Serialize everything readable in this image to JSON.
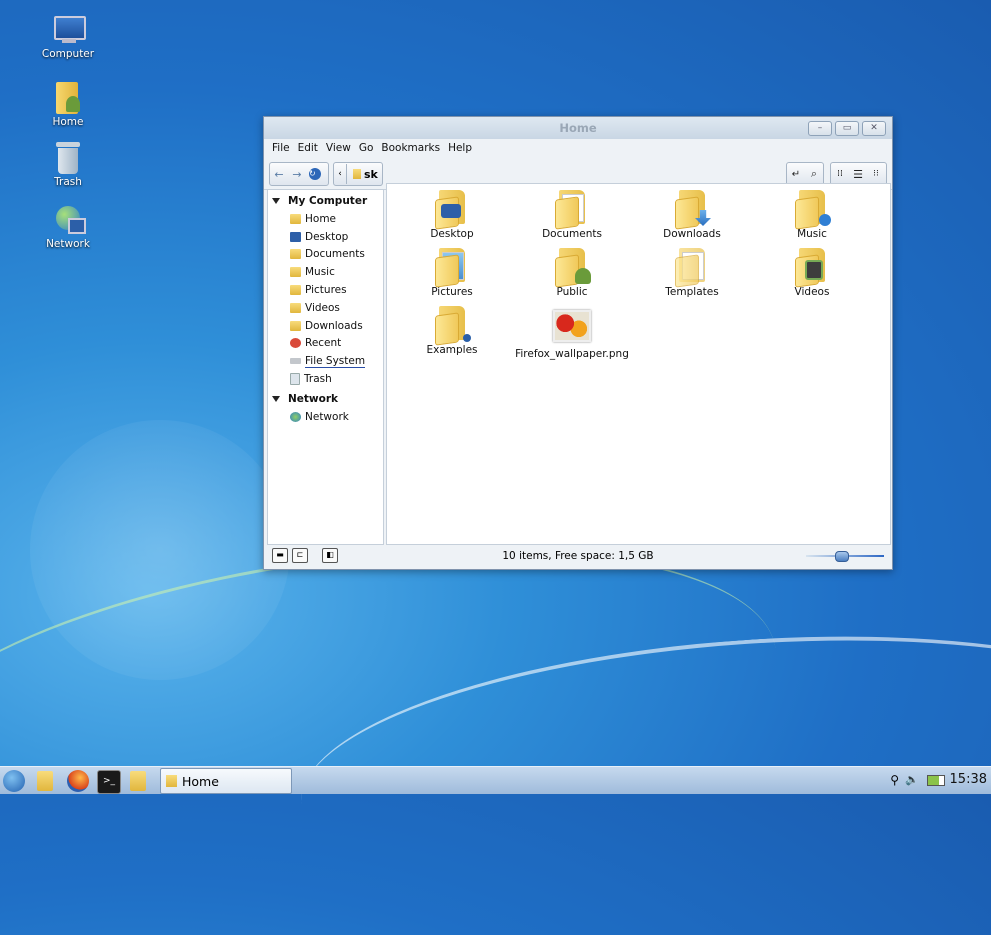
{
  "desktop": {
    "icons": [
      {
        "label": "Computer",
        "icon": "computer-icon"
      },
      {
        "label": "Home",
        "icon": "home-folder-icon"
      },
      {
        "label": "Trash",
        "icon": "trash-icon"
      },
      {
        "label": "Network",
        "icon": "network-icon"
      }
    ]
  },
  "window": {
    "title": "Home",
    "buttons": {
      "minimize": "–",
      "maximize": "▭",
      "close": "✕"
    },
    "menu": [
      "File",
      "Edit",
      "View",
      "Go",
      "Bookmarks",
      "Help"
    ],
    "location": {
      "path_label": "sk"
    },
    "sidebar": {
      "section1": "My Computer",
      "section1_items": [
        "Home",
        "Desktop",
        "Documents",
        "Music",
        "Pictures",
        "Videos",
        "Downloads",
        "Recent",
        "File System",
        "Trash"
      ],
      "section2": "Network",
      "section2_items": [
        "Network"
      ]
    },
    "items": [
      {
        "label": "Desktop",
        "icon": "folder-desktop-icon"
      },
      {
        "label": "Documents",
        "icon": "folder-documents-icon"
      },
      {
        "label": "Downloads",
        "icon": "folder-downloads-icon"
      },
      {
        "label": "Music",
        "icon": "folder-music-icon"
      },
      {
        "label": "Pictures",
        "icon": "folder-pictures-icon"
      },
      {
        "label": "Public",
        "icon": "folder-public-icon"
      },
      {
        "label": "Templates",
        "icon": "folder-templates-icon"
      },
      {
        "label": "Videos",
        "icon": "folder-videos-icon"
      },
      {
        "label": "Examples",
        "icon": "folder-examples-icon"
      },
      {
        "label": "Firefox_wallpaper.png",
        "icon": "image-file-icon"
      }
    ],
    "status": "10 items, Free space: 1,5 GB",
    "zoom_fraction": 0.45
  },
  "taskbar": {
    "task_label": "Home",
    "clock": "15:38"
  },
  "colors": {
    "accent": "#2f6fc4",
    "folder": "#f0c95a"
  }
}
